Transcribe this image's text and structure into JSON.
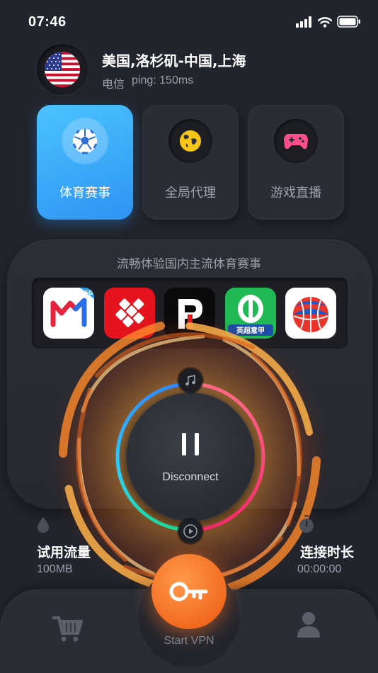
{
  "status_bar": {
    "time": "07:46"
  },
  "server": {
    "route": "美国,洛杉矶-中国,上海",
    "isp": "电信",
    "ping": "ping: 150ms",
    "flag": "us-flag"
  },
  "modes": [
    {
      "label": "体育赛事",
      "icon": "soccer-ball-icon",
      "active": true
    },
    {
      "label": "全局代理",
      "icon": "globe-icon",
      "active": false
    },
    {
      "label": "游戏直播",
      "icon": "gamepad-icon",
      "active": false
    }
  ],
  "panel": {
    "title": "流畅体验国内主流体育赛事",
    "apps": [
      {
        "name": "migu-video-app-icon",
        "badge": "5G"
      },
      {
        "name": "sports-app-red-icon"
      },
      {
        "name": "pp-sports-app-icon"
      },
      {
        "name": "dongqiudi-app-icon",
        "badge": "英超意甲"
      },
      {
        "name": "basketball-app-icon"
      }
    ]
  },
  "connect": {
    "label": "Disconnect"
  },
  "stats": {
    "traffic_title": "试用流量",
    "traffic_value": "100MB",
    "time_title": "连接时长",
    "time_value": "00:00:00"
  },
  "bottom_bar": {
    "vpn_label": "Start VPN"
  },
  "colors": {
    "background": "#22252d",
    "card": "#2a2d35",
    "active_blue": "#3aa8f8",
    "accent_orange": "#f26b1f",
    "ring_pink": "#ff3d7f",
    "ring_cyan": "#2fd4ff",
    "ring_green": "#20e3a2"
  }
}
